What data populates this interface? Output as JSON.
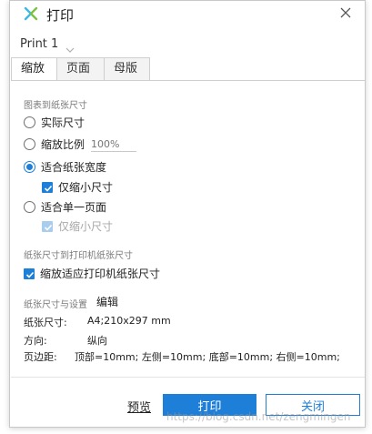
{
  "window": {
    "title": "打印"
  },
  "printer": {
    "selected": "Print 1"
  },
  "tabs": [
    {
      "label": "缩放",
      "active": true
    },
    {
      "label": "页面",
      "active": false
    },
    {
      "label": "母版",
      "active": false
    }
  ],
  "chart_to_paper": {
    "section_title": "图表到纸张尺寸",
    "actual_size": {
      "label": "实际尺寸",
      "checked": false
    },
    "scale_ratio": {
      "label": "缩放比例",
      "checked": false,
      "placeholder": "100%"
    },
    "fit_width": {
      "label": "适合纸张宽度",
      "checked": true
    },
    "fit_width_shrink_only": {
      "label": "仅缩小尺寸",
      "checked": true
    },
    "fit_single_page": {
      "label": "适合单一页面",
      "checked": false
    },
    "fit_page_shrink_only": {
      "label": "仅缩小尺寸",
      "checked": true,
      "disabled": true
    }
  },
  "paper_to_printer": {
    "section_title": "纸张尺寸到打印机纸张尺寸",
    "scale_to_printer": {
      "label": "缩放适应打印机纸张尺寸",
      "checked": true
    }
  },
  "paper_settings": {
    "section_title": "纸张尺寸与设置",
    "edit_label": "编辑",
    "rows": [
      {
        "key": "纸张尺寸:",
        "value": "A4;210x297 mm"
      },
      {
        "key": "方向:",
        "value": "纵向"
      },
      {
        "key": "页边距:",
        "value": "顶部=10mm; 左侧=10mm; 底部=10mm; 右侧=10mm;"
      }
    ]
  },
  "footer": {
    "preview_label": "预览",
    "print_label": "打印",
    "close_label": "关闭"
  },
  "watermark": "https://blog.csdn.net/zengmingen",
  "colors": {
    "accent": "#1e7fd8"
  }
}
